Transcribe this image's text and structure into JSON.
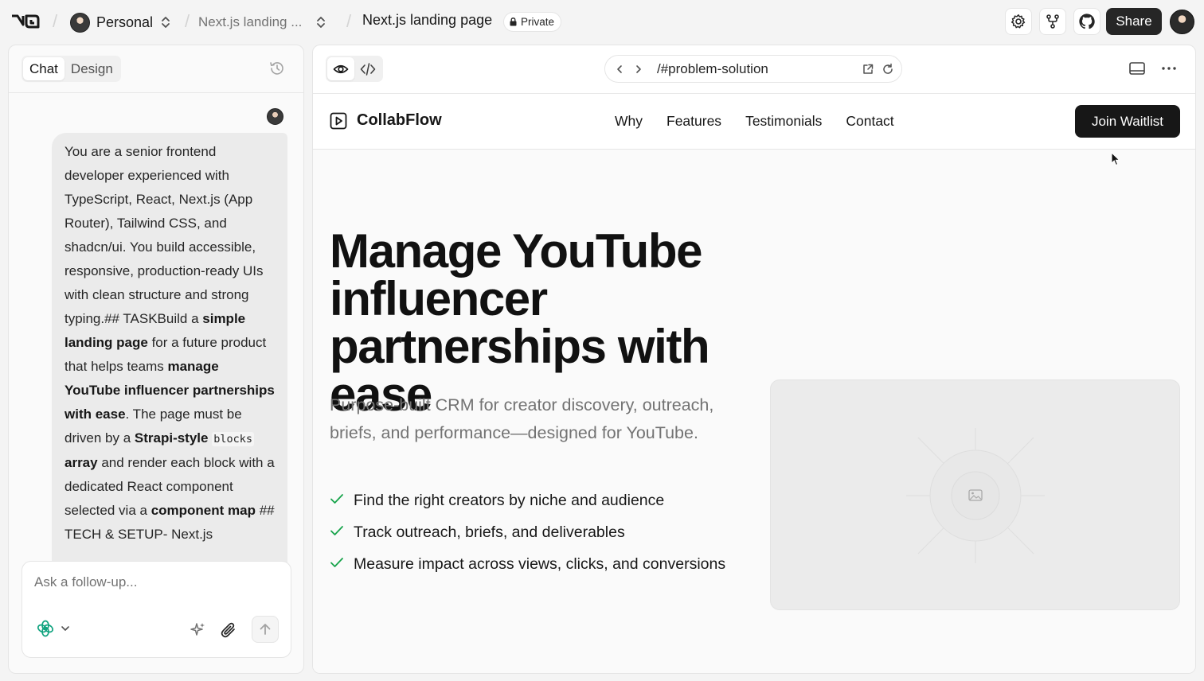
{
  "topbar": {
    "logo": "v0",
    "workspace": "Personal",
    "project": "Next.js landing ...",
    "chat_title": "Next.js landing page",
    "visibility": "Private",
    "share_label": "Share",
    "icons": [
      "settings-icon",
      "fork-icon",
      "github-icon"
    ]
  },
  "left_panel": {
    "tabs": [
      {
        "label": "Chat",
        "active": true
      },
      {
        "label": "Design",
        "active": false
      }
    ],
    "message": {
      "s1": "You are a senior frontend developer experienced with TypeScript, React, Next.js (App Router), Tailwind CSS, and shadcn/ui. You build accessible, responsive, production-ready UIs with clean structure and strong typing.## TASKBuild a ",
      "b1": "simple landing page",
      "s2": " for a future product that helps teams ",
      "b2": "manage YouTube influencer partnerships with ease",
      "s3": ". The page must be driven by a ",
      "b3": "Strapi-style ",
      "code1": "blocks",
      "b4": " array",
      "s4": " and render each block with a dedicated React component selected via a ",
      "b5": "component map",
      "s5": " ## TECH & SETUP- Next.js"
    },
    "composer": {
      "placeholder": "Ask a follow-up..."
    }
  },
  "preview": {
    "url": "/#problem-solution",
    "site": {
      "brand": "CollabFlow",
      "nav": [
        "Why",
        "Features",
        "Testimonials",
        "Contact"
      ],
      "cta": "Join Waitlist",
      "headline": "Manage YouTube influencer partnerships with ease",
      "subheadline": "Purpose-built CRM for creator discovery, outreach, briefs, and performance—designed for YouTube.",
      "features": [
        "Find the right creators by niche and audience",
        "Track outreach, briefs, and deliverables",
        "Measure impact across views, clicks, and conversions"
      ],
      "image_placeholder_icon": "image-icon"
    }
  },
  "colors": {
    "accent_dark": "#171717",
    "check_green": "#16a34a",
    "muted_text": "#737373"
  }
}
